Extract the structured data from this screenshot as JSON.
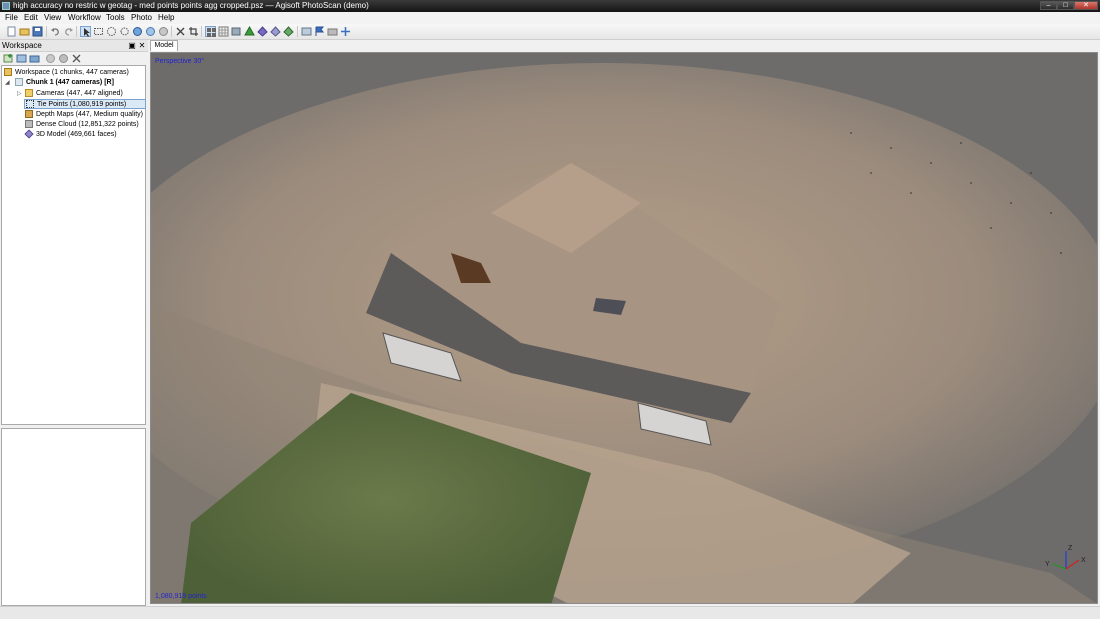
{
  "window": {
    "title": "high accuracy no restric w geotag - med points points agg cropped.psz — Agisoft PhotoScan (demo)",
    "controls": {
      "minimize": "–",
      "maximize": "□",
      "close": "✕"
    }
  },
  "menu": [
    "File",
    "Edit",
    "View",
    "Workflow",
    "Tools",
    "Photo",
    "Help"
  ],
  "toolbar_icons": [
    "new-icon",
    "open-icon",
    "save-icon",
    "undo-icon",
    "redo-icon",
    "navigation-icon",
    "rectangle-selection-icon",
    "circle-selection-icon",
    "free-form-selection-icon",
    "rotate-object-icon",
    "move-object-icon",
    "scale-object-icon",
    "delete-selection-icon",
    "crop-icon",
    "show-cameras-icon",
    "show-thumbnails-icon",
    "reset-view-icon",
    "point-cloud-icon",
    "dense-cloud-icon",
    "shaded-model-icon",
    "solid-model-icon",
    "wireframe-icon",
    "textured-model-icon",
    "show-regions-icon",
    "markers-icon",
    "show-shapes-icon",
    "navigation-cross-icon"
  ],
  "workspace": {
    "header": "Workspace",
    "tree": {
      "root": "Workspace (1 chunks, 447 cameras)",
      "chunk": "Chunk 1 (447 cameras) [R]",
      "items": [
        {
          "label": "Cameras (447, 447 aligned)",
          "icon": "folder-icon"
        },
        {
          "label": "Tie Points (1,080,919 points)",
          "icon": "tie-points-icon"
        },
        {
          "label": "Depth Maps (447, Medium quality)",
          "icon": "depth-maps-icon"
        },
        {
          "label": "Dense Cloud (12,851,322 points)",
          "icon": "dense-cloud-icon"
        },
        {
          "label": "3D Model (469,661 faces)",
          "icon": "mesh-icon"
        }
      ]
    }
  },
  "model_tab": "Model",
  "viewport": {
    "projection": "Perspective 30°",
    "point_count": "1,080,919 points",
    "axis_labels": {
      "x": "X",
      "y": "Y",
      "z": "Z"
    }
  },
  "colors": {
    "viewport_bg": "#6e6c6a",
    "overlay_text": "#2424d0",
    "selection": "#dbe9f7"
  }
}
